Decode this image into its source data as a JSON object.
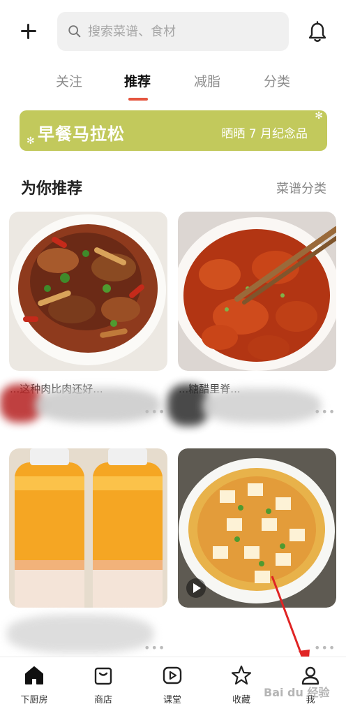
{
  "header": {
    "add_icon": "plus-icon",
    "search_placeholder": "搜索菜谱、食材",
    "notification_icon": "bell-icon"
  },
  "tabs": [
    {
      "label": "关注",
      "active": false
    },
    {
      "label": "推荐",
      "active": true
    },
    {
      "label": "减脂",
      "active": false
    },
    {
      "label": "分类",
      "active": false
    }
  ],
  "banner": {
    "title": "早餐马拉松",
    "subtitle": "晒晒 7 月纪念品",
    "color": "#c2c95c"
  },
  "section": {
    "title": "为你推荐",
    "link": "菜谱分类"
  },
  "cards": [
    {
      "title": "...这种肉比肉还好...",
      "more": "•••"
    },
    {
      "title": "...糖醋里脊...",
      "more": "•••"
    },
    {
      "title": "",
      "more": "•••"
    },
    {
      "title": "",
      "more": "•••"
    }
  ],
  "bottom_nav": [
    {
      "label": "下厨房",
      "icon": "home-icon",
      "active": true
    },
    {
      "label": "商店",
      "icon": "shop-icon",
      "active": false
    },
    {
      "label": "课堂",
      "icon": "play-icon",
      "active": false
    },
    {
      "label": "收藏",
      "icon": "star-icon",
      "active": false
    },
    {
      "label": "我",
      "icon": "user-icon",
      "active": false
    }
  ],
  "watermark": "Bai du 经验",
  "colors": {
    "accent": "#e5553f",
    "banner": "#c2c95c",
    "arrow": "#e02424"
  }
}
